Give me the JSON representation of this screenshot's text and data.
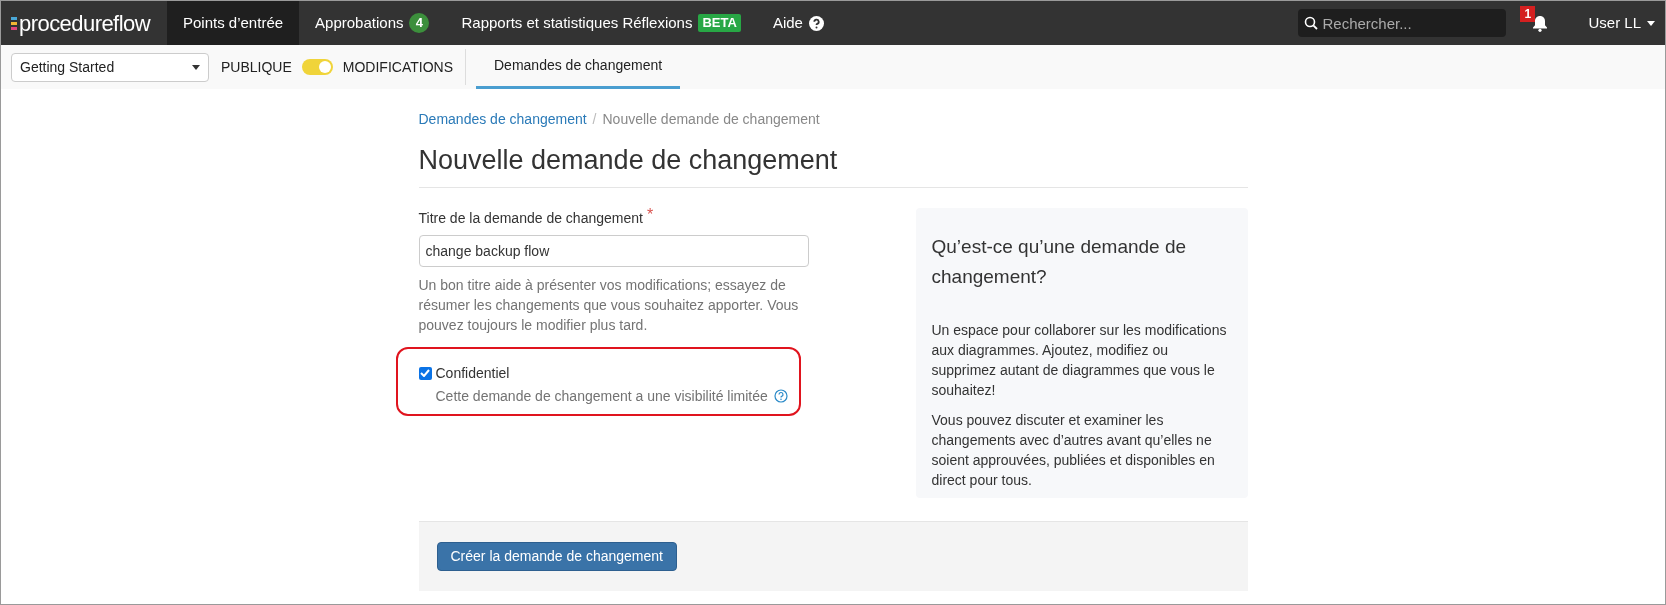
{
  "logo": "procedureflow",
  "nav": [
    {
      "label": "Points d’entrée",
      "selected": true
    },
    {
      "label": "Approbations",
      "selected": false,
      "badge": {
        "kind": "count",
        "text": "4"
      }
    },
    {
      "label": "Rapports et statistiques Réflexions",
      "selected": false,
      "badge": {
        "kind": "tag",
        "text": "BETA"
      }
    },
    {
      "label": "Aide",
      "selected": false,
      "help_icon": true
    }
  ],
  "search": {
    "placeholder": "Rechercher..."
  },
  "notifications": {
    "count": "1"
  },
  "user_menu": "User LL",
  "subbar": {
    "dropdown": "Getting Started",
    "toggle_left": "PUBLIQUE",
    "toggle_on": true,
    "toggle_right": "MODIFICATIONS",
    "tabs": [
      {
        "label": "Demandes de changement",
        "selected": true
      }
    ]
  },
  "breadcrumb_separator": "/",
  "breadcrumb": [
    {
      "label": "Demandes de changement",
      "link": true
    },
    {
      "label": "Nouvelle demande de changement",
      "link": false
    }
  ],
  "heading": "Nouvelle demande de changement",
  "form": {
    "label": "Titre de la demande de changement",
    "required_mark": "*",
    "value": "change backup flow",
    "help": "Un bon titre aide à présenter vos modifications; essayez de résumer les changements que vous souhaitez apporter. Vous pouvez toujours le modifier plus tard.",
    "confidential": {
      "label": "Confidentiel",
      "checked": true,
      "description": "Cette demande de changement a une visibilité limitée"
    }
  },
  "info_panel": {
    "title": "Qu’est-ce qu’une demande de changement?",
    "paragraphs": [
      "Un espace pour collaborer sur les modifications aux diagrammes. Ajoutez, modifiez ou supprimez autant de diagrammes que vous le souhaitez!",
      "Vous pouvez discuter et examiner les changements avec d’autres avant qu’elles ne soient approuvées, publiées et disponibles en direct pour tous."
    ]
  },
  "submit_button": "Créer la demande de changement"
}
